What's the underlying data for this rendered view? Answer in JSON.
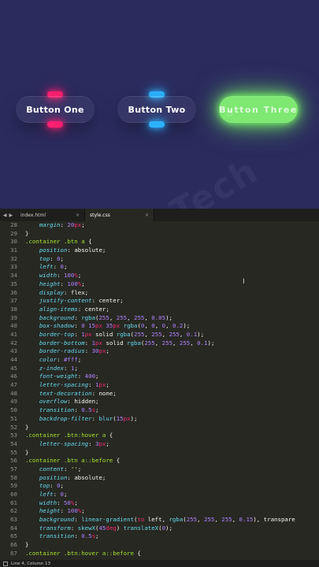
{
  "preview": {
    "buttons": [
      {
        "label": "Button One",
        "glow": "#ff1f71"
      },
      {
        "label": "Button Two",
        "glow": "#2db2ff"
      },
      {
        "label": "Button Three",
        "glow": "#72e866",
        "hover": true
      }
    ],
    "watermark": "SoftTech",
    "background": "#2b2b5e"
  },
  "tabs": [
    {
      "label": "index.html",
      "active": false
    },
    {
      "label": "style.css",
      "active": true
    }
  ],
  "status": {
    "position": "Line 4, Column 13"
  },
  "code_lines": [
    {
      "n": "28",
      "html": "    <span class='prop'>margin</span>: <span class='num'>20</span><span class='unit'>px</span>;"
    },
    {
      "n": "29",
      "html": "}"
    },
    {
      "n": "30",
      "html": "<span class='sel'>.container .btn a</span> {"
    },
    {
      "n": "31",
      "html": "    <span class='prop'>position</span>: absolute;"
    },
    {
      "n": "32",
      "html": "    <span class='prop'>top</span>: <span class='num'>0</span>;"
    },
    {
      "n": "33",
      "html": "    <span class='prop'>left</span>: <span class='num'>0</span>;"
    },
    {
      "n": "34",
      "html": "    <span class='prop'>width</span>: <span class='num'>100</span><span class='unit'>%</span>;"
    },
    {
      "n": "35",
      "html": "    <span class='prop'>height</span>: <span class='num'>100</span><span class='unit'>%</span>;"
    },
    {
      "n": "36",
      "html": "    <span class='prop'>display</span>: flex;"
    },
    {
      "n": "37",
      "html": "    <span class='prop'>justify-content</span>: center;"
    },
    {
      "n": "38",
      "html": "    <span class='prop'>align-items</span>: center;"
    },
    {
      "n": "39",
      "html": "    <span class='prop'>background</span>: <span class='fn'>rgba</span>(<span class='num'>255</span>, <span class='num'>255</span>, <span class='num'>255</span>, <span class='num'>0.05</span>);"
    },
    {
      "n": "40",
      "html": "    <span class='prop'>box-shadow</span>: <span class='num'>0</span> <span class='num'>15</span><span class='unit'>px</span> <span class='num'>35</span><span class='unit'>px</span> <span class='fn'>rgba</span>(<span class='num'>0</span>, <span class='num'>0</span>, <span class='num'>0</span>, <span class='num'>0.2</span>);"
    },
    {
      "n": "41",
      "html": "    <span class='prop'>border-top</span>: <span class='num'>1</span><span class='unit'>px</span> solid <span class='fn'>rgba</span>(<span class='num'>255</span>, <span class='num'>255</span>, <span class='num'>255</span>, <span class='num'>0.1</span>);"
    },
    {
      "n": "42",
      "html": "    <span class='prop'>border-bottom</span>: <span class='num'>1</span><span class='unit'>px</span> solid <span class='fn'>rgba</span>(<span class='num'>255</span>, <span class='num'>255</span>, <span class='num'>255</span>, <span class='num'>0.1</span>);"
    },
    {
      "n": "43",
      "html": "    <span class='prop'>border-radius</span>: <span class='num'>30</span><span class='unit'>px</span>;"
    },
    {
      "n": "44",
      "html": "    <span class='prop'>color</span>: <span class='num'>#fff</span>;"
    },
    {
      "n": "45",
      "html": "    <span class='prop'>z-index</span>: <span class='num'>1</span>;"
    },
    {
      "n": "46",
      "html": "    <span class='prop'>font-weight</span>: <span class='num'>400</span>;"
    },
    {
      "n": "47",
      "html": "    <span class='prop'>letter-spacing</span>: <span class='num'>1</span><span class='unit'>px</span>;"
    },
    {
      "n": "48",
      "html": "    <span class='prop'>text-decoration</span>: none;"
    },
    {
      "n": "49",
      "html": "    <span class='prop'>overflow</span>: hidden;"
    },
    {
      "n": "50",
      "html": "    <span class='prop'>transition</span>: <span class='num'>0.5</span><span class='unit'>s</span>;"
    },
    {
      "n": "51",
      "html": "    <span class='prop'>backdrop-filter</span>: <span class='fn'>blur</span>(<span class='num'>15</span><span class='unit'>px</span>);"
    },
    {
      "n": "52",
      "html": "}"
    },
    {
      "n": "53",
      "html": "<span class='sel'>.container .btn:hover a</span> {"
    },
    {
      "n": "54",
      "html": "    <span class='prop'>letter-spacing</span>: <span class='num'>3</span><span class='unit'>px</span>;"
    },
    {
      "n": "55",
      "html": "}"
    },
    {
      "n": "56",
      "html": "<span class='sel'>.container .btn a::before</span> {"
    },
    {
      "n": "57",
      "html": "    <span class='prop'>content</span>: <span class='str'>''</span>;"
    },
    {
      "n": "58",
      "html": "    <span class='prop'>position</span>: absolute;"
    },
    {
      "n": "59",
      "html": "    <span class='prop'>top</span>: <span class='num'>0</span>;"
    },
    {
      "n": "60",
      "html": "    <span class='prop'>left</span>: <span class='num'>0</span>;"
    },
    {
      "n": "61",
      "html": "    <span class='prop'>width</span>: <span class='num'>50</span><span class='unit'>%</span>;"
    },
    {
      "n": "62",
      "html": "    <span class='prop'>height</span>: <span class='num'>100</span><span class='unit'>%</span>;"
    },
    {
      "n": "63",
      "html": "    <span class='prop'>background</span>: <span class='fn'>linear-gradient</span>(<span class='kw'>to</span> left, <span class='fn'>rgba</span>(<span class='num'>255</span>, <span class='num'>255</span>, <span class='num'>255</span>, <span class='num'>0.15</span>), transpare"
    },
    {
      "n": "64",
      "html": "    <span class='prop'>transform</span>: <span class='fn'>skewX</span>(<span class='num'>45</span><span class='unit'>deg</span>) <span class='fn'>translateX</span>(<span class='num'>0</span>);"
    },
    {
      "n": "65",
      "html": "    <span class='prop'>transition</span>: <span class='num'>0.5</span><span class='unit'>s</span>;"
    },
    {
      "n": "66",
      "html": "}"
    },
    {
      "n": "67",
      "html": "<span class='sel'>.container .btn:hover a::before</span> {"
    }
  ]
}
